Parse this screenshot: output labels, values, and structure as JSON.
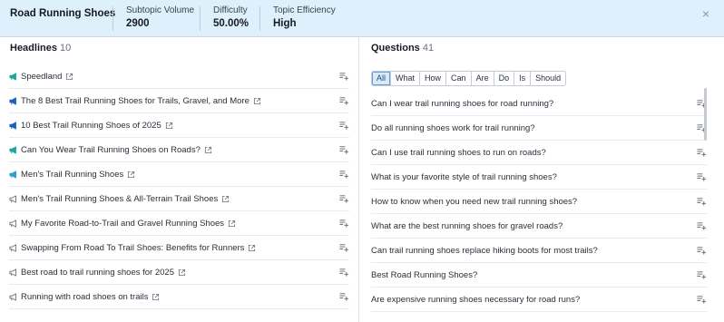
{
  "header": {
    "title": "Road Running Shoes",
    "metrics": [
      {
        "label": "Subtopic Volume",
        "value": "2900"
      },
      {
        "label": "Difficulty",
        "value": "50.00%"
      },
      {
        "label": "Topic Efficiency",
        "value": "High"
      }
    ],
    "close_glyph": "×"
  },
  "headlines": {
    "title": "Headlines",
    "count": "10",
    "items": [
      {
        "text": "Speedland",
        "icon": "megaphone-icon",
        "icon_color": "#1aa7a0"
      },
      {
        "text": "The 8 Best Trail Running Shoes for Trails, Gravel, and More",
        "icon": "megaphone-icon",
        "icon_color": "#1f5fbf"
      },
      {
        "text": "10 Best Trail Running Shoes of 2025",
        "icon": "megaphone-icon",
        "icon_color": "#1f5fbf"
      },
      {
        "text": "Can You Wear Trail Running Shoes on Roads?",
        "icon": "megaphone-icon",
        "icon_color": "#1aa7a0"
      },
      {
        "text": "Men's Trail Running Shoes",
        "icon": "megaphone-icon",
        "icon_color": "#2a9fd6"
      },
      {
        "text": "Men's Trail Running Shoes & All-Terrain Trail Shoes",
        "icon": "megaphone-outline-icon",
        "icon_color": "#6b7380"
      },
      {
        "text": "My Favorite Road-to-Trail and Gravel Running Shoes",
        "icon": "megaphone-outline-icon",
        "icon_color": "#6b7380"
      },
      {
        "text": "Swapping From Road To Trail Shoes: Benefits for Runners",
        "icon": "megaphone-outline-icon",
        "icon_color": "#6b7380"
      },
      {
        "text": "Best road to trail running shoes for 2025",
        "icon": "megaphone-outline-icon",
        "icon_color": "#6b7380"
      },
      {
        "text": "Running with road shoes on trails",
        "icon": "megaphone-outline-icon",
        "icon_color": "#6b7380"
      }
    ]
  },
  "questions": {
    "title": "Questions",
    "count": "41",
    "filters": [
      "All",
      "What",
      "How",
      "Can",
      "Are",
      "Do",
      "Is",
      "Should"
    ],
    "active_filter": "All",
    "items": [
      "Can I wear trail running shoes for road running?",
      "Do all running shoes work for trail running?",
      "Can I use trail running shoes to run on roads?",
      "What is your favorite style of trail running shoes?",
      "How to know when you need new trail running shoes?",
      "What are the best running shoes for gravel roads?",
      "Can trail running shoes replace hiking boots for most trails?",
      "Best Road Running Shoes?",
      "Are expensive running shoes necessary for road runs?"
    ]
  },
  "colors": {
    "header_bg": "#ddf0fb",
    "active_filter_bg": "#dbe9f7"
  }
}
